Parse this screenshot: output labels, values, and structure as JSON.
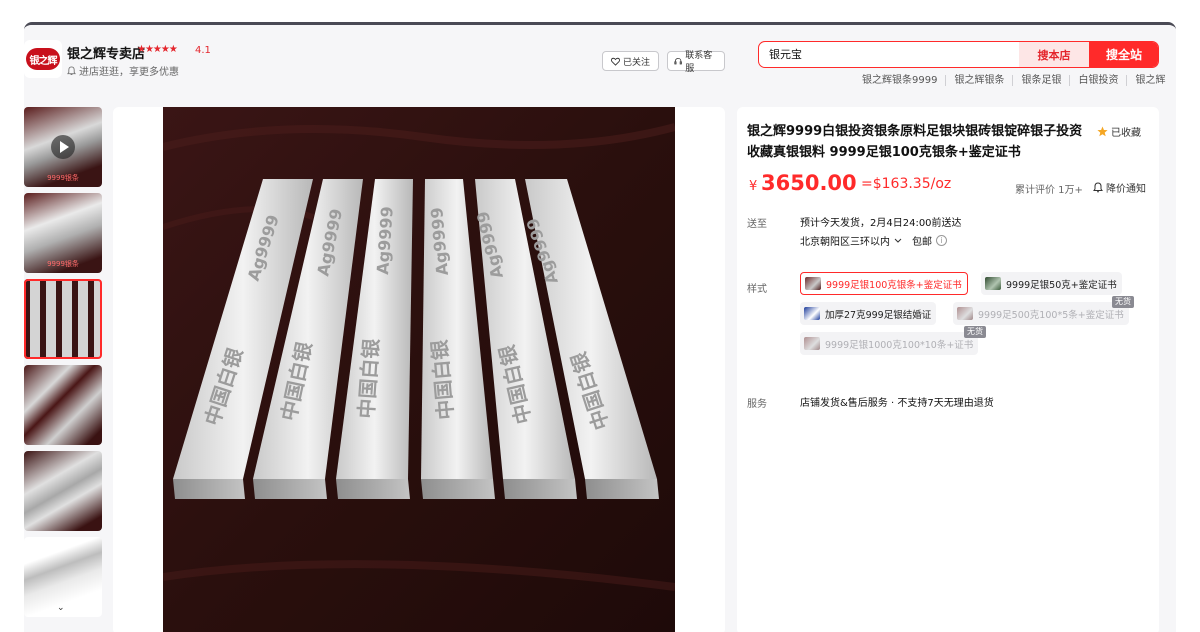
{
  "shop": {
    "logo_text": "银之辉",
    "name": "银之辉专卖店",
    "stars": "★★★★★",
    "rating": "4.1",
    "subtitle": "进店逛逛，享更多优惠",
    "follow_label": "已关注",
    "service_label": "联系客服"
  },
  "search": {
    "query": "银元宝",
    "shop_button": "搜本店",
    "all_button": "搜全站"
  },
  "hot_terms": [
    "银之辉银条9999",
    "银之辉银条",
    "银条足银",
    "白银投资",
    "银之辉"
  ],
  "gallery": {
    "captions": [
      "9999银条",
      "9999银条",
      "",
      "",
      "",
      ""
    ],
    "active_index": 2,
    "more_label": "⌄"
  },
  "main_image": {
    "bar_stamp": "Ag9999",
    "bar_text": "中国白银"
  },
  "product": {
    "title": "银之辉9999白银投资银条原料足银块银砖银锭碎银子投资收藏真银银料 9999足银100克银条+鉴定证书",
    "favorite_label": "已收藏",
    "currency_symbol": "¥",
    "price": "3650.00",
    "price_usd": "=$163.35/oz",
    "reviews": "累计评价 1万+",
    "notify_label": "降价通知",
    "ship_label": "送至",
    "ship_line1": "预计今天发货，2月4日24:00前送达",
    "ship_location": "北京朝阳区三环以内",
    "ship_free": "包邮",
    "style_label": "样式",
    "service_label": "服务",
    "service_text": "店铺发货&售后服务 · 不支持7天无理由退货"
  },
  "options": [
    {
      "label": "9999足银100克银条+鉴定证书",
      "state": "selected"
    },
    {
      "label": "9999足银50克+鉴定证书",
      "state": "normal"
    },
    {
      "label": "加厚27克999足银结婚证",
      "state": "normal"
    },
    {
      "label": "9999足500克100*5条+鉴定证书",
      "state": "disabled"
    },
    {
      "label": "9999足银1000克100*10条+证书",
      "state": "disabled"
    }
  ],
  "sold_out_label": "无货",
  "colors": {
    "accent": "#ff2a2a",
    "star": "#e4262d",
    "favorite_star": "#f5a623"
  }
}
